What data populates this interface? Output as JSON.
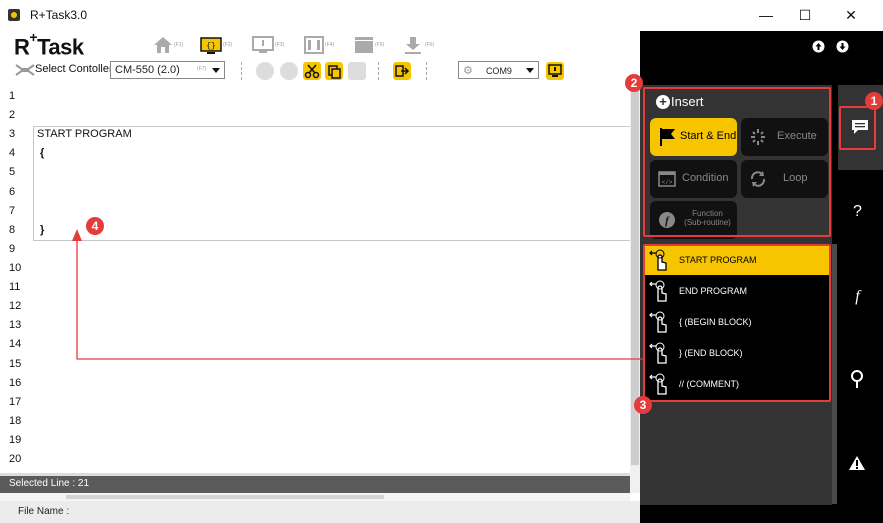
{
  "window": {
    "title": "R+Task3.0",
    "minimize": "—",
    "maximize": "☐",
    "close": "✕"
  },
  "logo": {
    "text": "R",
    "plus": "+",
    "word": "Task"
  },
  "toolbar1": {
    "keys": [
      "(F1)",
      "(F2)",
      "(F3)",
      "(F4)",
      "(F5)",
      "(F6)"
    ]
  },
  "toolbar2": {
    "select_controller_label": "Select Contoller",
    "controller_value": "CM-550 (2.0)",
    "controller_key": "(F7)",
    "port_value": "COM9"
  },
  "editor": {
    "line_numbers": [
      "1",
      "2",
      "3",
      "4",
      "5",
      "6",
      "7",
      "8",
      "9",
      "10",
      "11",
      "12",
      "13",
      "14",
      "15",
      "16",
      "17",
      "18",
      "19",
      "20"
    ],
    "code": {
      "start": "START PROGRAM",
      "open_brace": "{",
      "close_brace": "}"
    }
  },
  "status": {
    "selected_line": "Selected Line : 21",
    "file_name": "File Name :"
  },
  "panel": {
    "insert_label": "Insert",
    "categories": [
      {
        "label": "Start & End",
        "active": true
      },
      {
        "label": "Execute",
        "active": false
      },
      {
        "label": "Condition",
        "active": false
      },
      {
        "label": "Loop",
        "active": false
      },
      {
        "label": "Function",
        "sub": "(Sub-routine)",
        "active": false
      }
    ],
    "commands": [
      {
        "label": "START PROGRAM",
        "active": true
      },
      {
        "label": "END PROGRAM",
        "active": false
      },
      {
        "label": "{  (BEGIN BLOCK)",
        "active": false
      },
      {
        "label": "}  (END BLOCK)",
        "active": false
      },
      {
        "label": "//  (COMMENT)",
        "active": false
      }
    ]
  },
  "side_tabs": [
    "?",
    "f"
  ],
  "annotations": {
    "badges": [
      "1",
      "2",
      "3",
      "4"
    ],
    "color": "#e53b3b"
  },
  "colors": {
    "accent": "#f7c400",
    "panel_dark": "#000000",
    "panel_mid": "#333333"
  }
}
